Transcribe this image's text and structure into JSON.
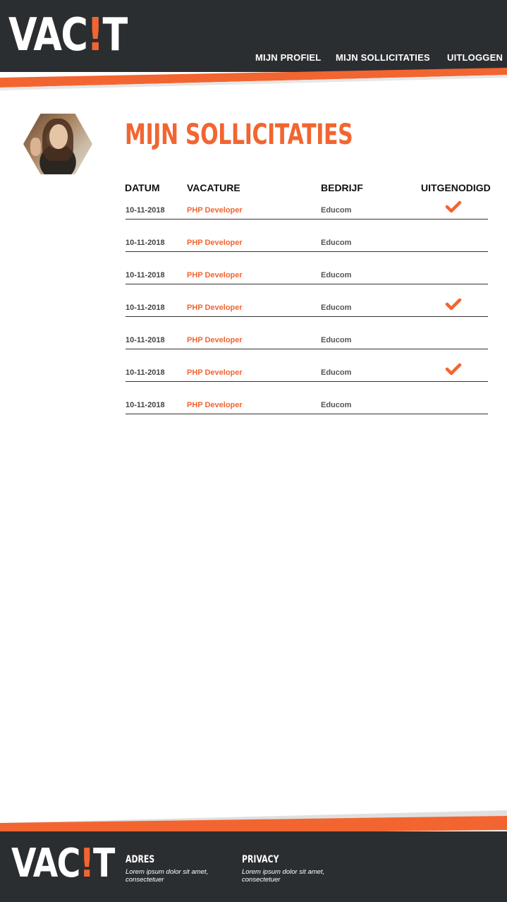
{
  "brand": {
    "logo_pre": "VAC",
    "logo_bang": "!",
    "logo_post": "T",
    "accent_color": "#f26531",
    "dark_color": "#2b2e31"
  },
  "nav": {
    "profiel": "MIJN PROFIEL",
    "sollicitaties": "MIJN SOLLICITATIES",
    "uitloggen": "UITLOGGEN"
  },
  "page": {
    "title": "MIJN SOLLICITATIES"
  },
  "table": {
    "headers": {
      "datum": "DATUM",
      "vacature": "VACATURE",
      "bedrijf": "BEDRIJF",
      "uitgenodigd": "UITGENODIGD"
    },
    "rows": [
      {
        "datum": "10-11-2018",
        "vacature": "PHP Developer",
        "bedrijf": "Educom",
        "uitgenodigd": true
      },
      {
        "datum": "10-11-2018",
        "vacature": "PHP Developer",
        "bedrijf": "Educom",
        "uitgenodigd": false
      },
      {
        "datum": "10-11-2018",
        "vacature": "PHP Developer",
        "bedrijf": "Educom",
        "uitgenodigd": false
      },
      {
        "datum": "10-11-2018",
        "vacature": "PHP Developer",
        "bedrijf": "Educom",
        "uitgenodigd": true
      },
      {
        "datum": "10-11-2018",
        "vacature": "PHP Developer",
        "bedrijf": "Educom",
        "uitgenodigd": false
      },
      {
        "datum": "10-11-2018",
        "vacature": "PHP Developer",
        "bedrijf": "Educom",
        "uitgenodigd": true
      },
      {
        "datum": "10-11-2018",
        "vacature": "PHP Developer",
        "bedrijf": "Educom",
        "uitgenodigd": false
      }
    ]
  },
  "footer": {
    "adres_title": "ADRES",
    "adres_text": "Lorem ipsum dolor sit amet, consectetuer",
    "privacy_title": "PRIVACY",
    "privacy_text": "Lorem ipsum dolor sit amet, consectetuer"
  }
}
